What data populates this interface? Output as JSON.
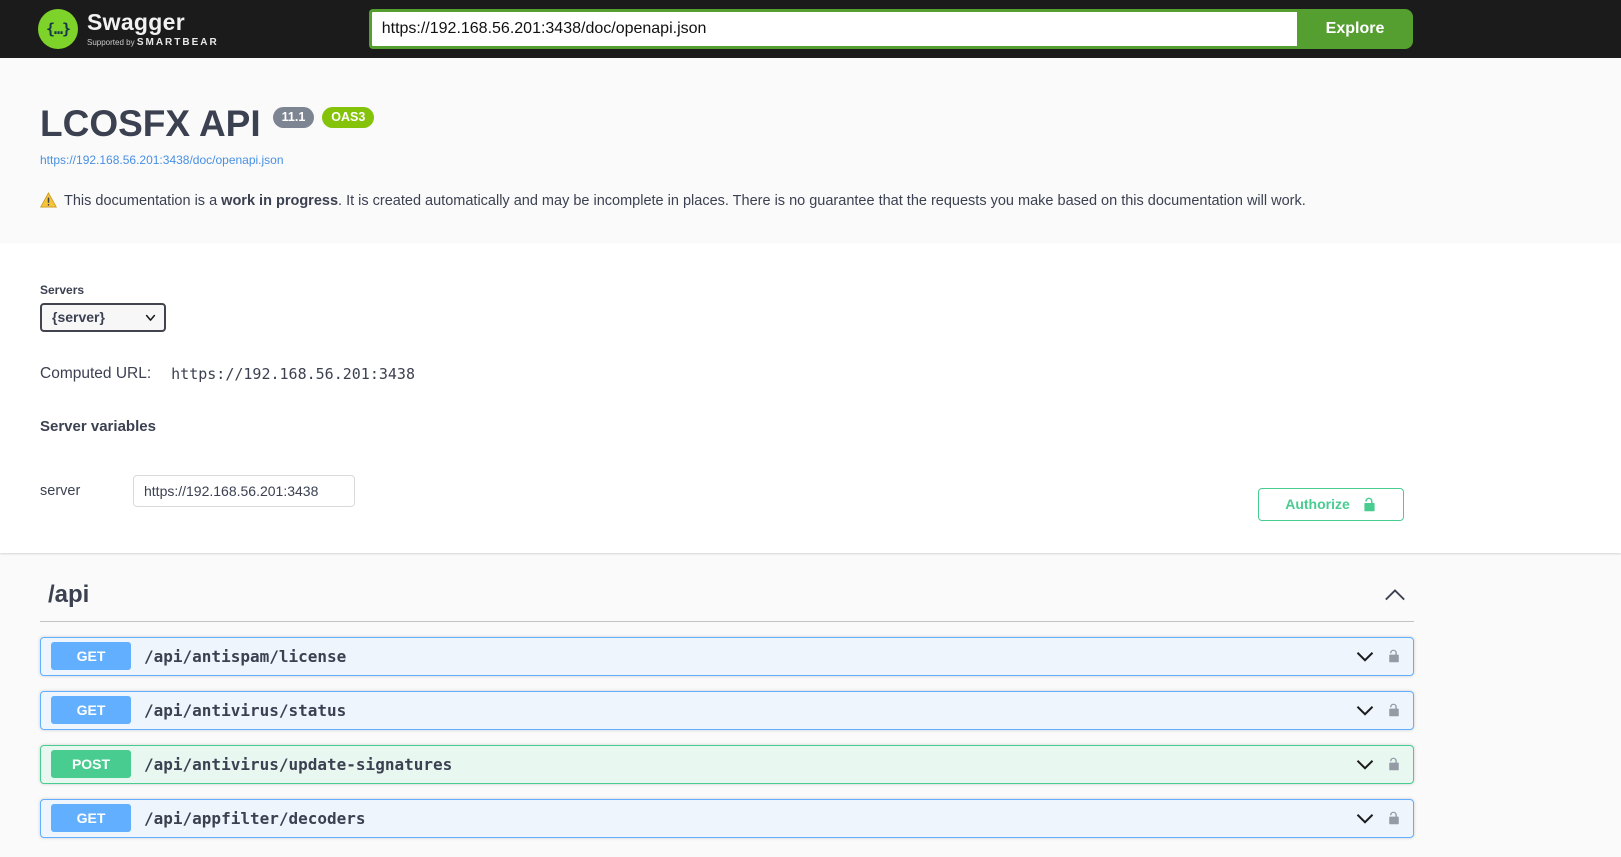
{
  "topbar": {
    "logo_braces": "{…}",
    "logo_text": "Swagger",
    "logo_tagline_prefix": "Supported by",
    "logo_tagline_brand": "SMARTBEAR",
    "url_value": "https://192.168.56.201:3438/doc/openapi.json",
    "explore_label": "Explore"
  },
  "info": {
    "title": "LCOSFX API",
    "version_badge": "11.1",
    "oas_badge": "OAS3",
    "spec_link": "https://192.168.56.201:3438/doc/openapi.json",
    "description_prefix": "This documentation is a ",
    "description_bold": "work in progress",
    "description_suffix": ". It is created automatically and may be incomplete in places. There is no guarantee that the requests you make based on this documentation will work."
  },
  "servers": {
    "label": "Servers",
    "selected_option": "{server}",
    "computed_url_label": "Computed URL:",
    "computed_url_value": "https://192.168.56.201:3438",
    "variables_heading": "Server variables",
    "variable_name": "server",
    "variable_value": "https://192.168.56.201:3438"
  },
  "auth": {
    "authorize_label": "Authorize"
  },
  "api_section": {
    "tag": "/api",
    "operations": [
      {
        "method": "GET",
        "path": "/api/antispam/license"
      },
      {
        "method": "GET",
        "path": "/api/antivirus/status"
      },
      {
        "method": "POST",
        "path": "/api/antivirus/update-signatures"
      },
      {
        "method": "GET",
        "path": "/api/appfilter/decoders"
      }
    ]
  },
  "colors": {
    "topbar_bg": "#1b1b1b",
    "explore_green": "#549f2f",
    "logo_green": "#7ed32a",
    "get_blue": "#61affe",
    "post_green": "#49cc90",
    "authorize_green": "#49cc90",
    "link_blue": "#4990e2",
    "text": "#3b4151",
    "version_badge_bg": "#7d8492",
    "oas_badge_bg": "#84c309"
  }
}
